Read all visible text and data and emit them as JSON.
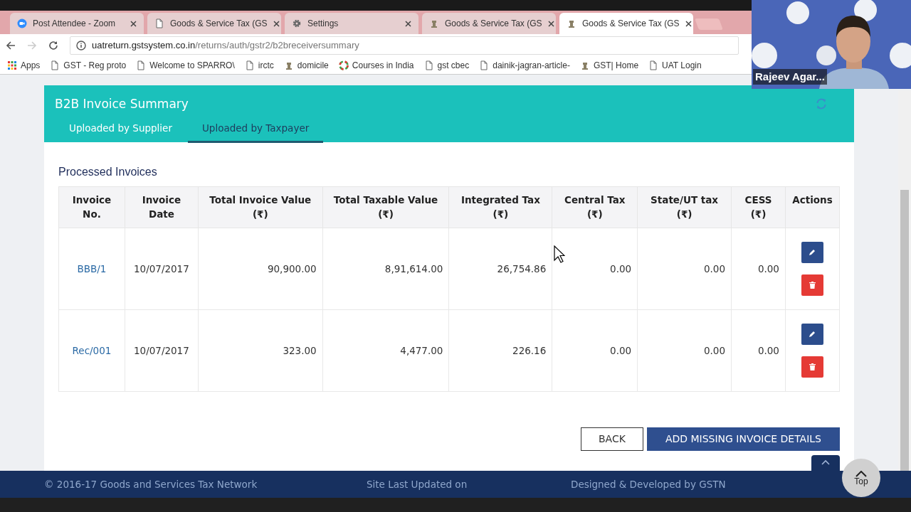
{
  "browser": {
    "tabs": [
      {
        "title": "Post Attendee - Zoom",
        "kind": "camera",
        "selected": false
      },
      {
        "title": "Goods & Service Tax (GS",
        "kind": "page",
        "selected": false
      },
      {
        "title": "Settings",
        "kind": "gear",
        "selected": false
      },
      {
        "title": "Goods & Service Tax (GS",
        "kind": "emblem",
        "selected": false
      },
      {
        "title": "Goods & Service Tax (GS",
        "kind": "emblem",
        "selected": true
      }
    ],
    "url_host": "uatreturn.gstsystem.co.in",
    "url_path": "/returns/auth/gstr2/b2breceiversummary",
    "bookmarks": [
      {
        "label": "Apps",
        "kind": "grid"
      },
      {
        "label": "GST - Reg proto",
        "kind": "page"
      },
      {
        "label": "Welcome to SPARRO\\",
        "kind": "page"
      },
      {
        "label": "irctc",
        "kind": "page"
      },
      {
        "label": "domicile",
        "kind": "emblem"
      },
      {
        "label": "Courses in India",
        "kind": "ring"
      },
      {
        "label": "gst cbec",
        "kind": "page"
      },
      {
        "label": "dainik-jagran-article-",
        "kind": "page"
      },
      {
        "label": "GST| Home",
        "kind": "emblem"
      },
      {
        "label": "UAT Login",
        "kind": "page"
      }
    ]
  },
  "video": {
    "name": "Rajeev Agar..."
  },
  "panel": {
    "title": "B2B Invoice Summary",
    "tabs": [
      {
        "label": "Uploaded by Supplier",
        "selected": false
      },
      {
        "label": "Uploaded by Taxpayer",
        "selected": true
      }
    ],
    "section_title": "Processed Invoices",
    "table": {
      "columns": [
        {
          "label": "Invoice No."
        },
        {
          "label": "Invoice Date"
        },
        {
          "label": "Total Invoice Value",
          "unit": "(₹)"
        },
        {
          "label": "Total Taxable Value",
          "unit": "(₹)"
        },
        {
          "label": "Integrated Tax",
          "unit": "(₹)"
        },
        {
          "label": "Central Tax",
          "unit": "(₹)"
        },
        {
          "label": "State/UT tax",
          "unit": "(₹)"
        },
        {
          "label": "CESS",
          "unit": "(₹)"
        },
        {
          "label": "Actions"
        }
      ],
      "rows": [
        {
          "invoice_no": "BBB/1",
          "date": "10/07/2017",
          "values": [
            "90,900.00",
            "8,91,614.00",
            "26,754.86",
            "0.00",
            "0.00",
            "0.00"
          ]
        },
        {
          "invoice_no": "Rec/001",
          "date": "10/07/2017",
          "values": [
            "323.00",
            "4,477.00",
            "226.16",
            "0.00",
            "0.00",
            "0.00"
          ]
        }
      ]
    },
    "buttons": [
      {
        "label": "BACK",
        "kind": "outline"
      },
      {
        "label": "ADD MISSING INVOICE DETAILS",
        "kind": "primary"
      }
    ],
    "top_button": "Top"
  },
  "footer": {
    "copyright": "© 2016-17 Goods and Services Tax Network",
    "updated": "Site Last Updated on",
    "credit": "Designed & Developed by GSTN"
  }
}
